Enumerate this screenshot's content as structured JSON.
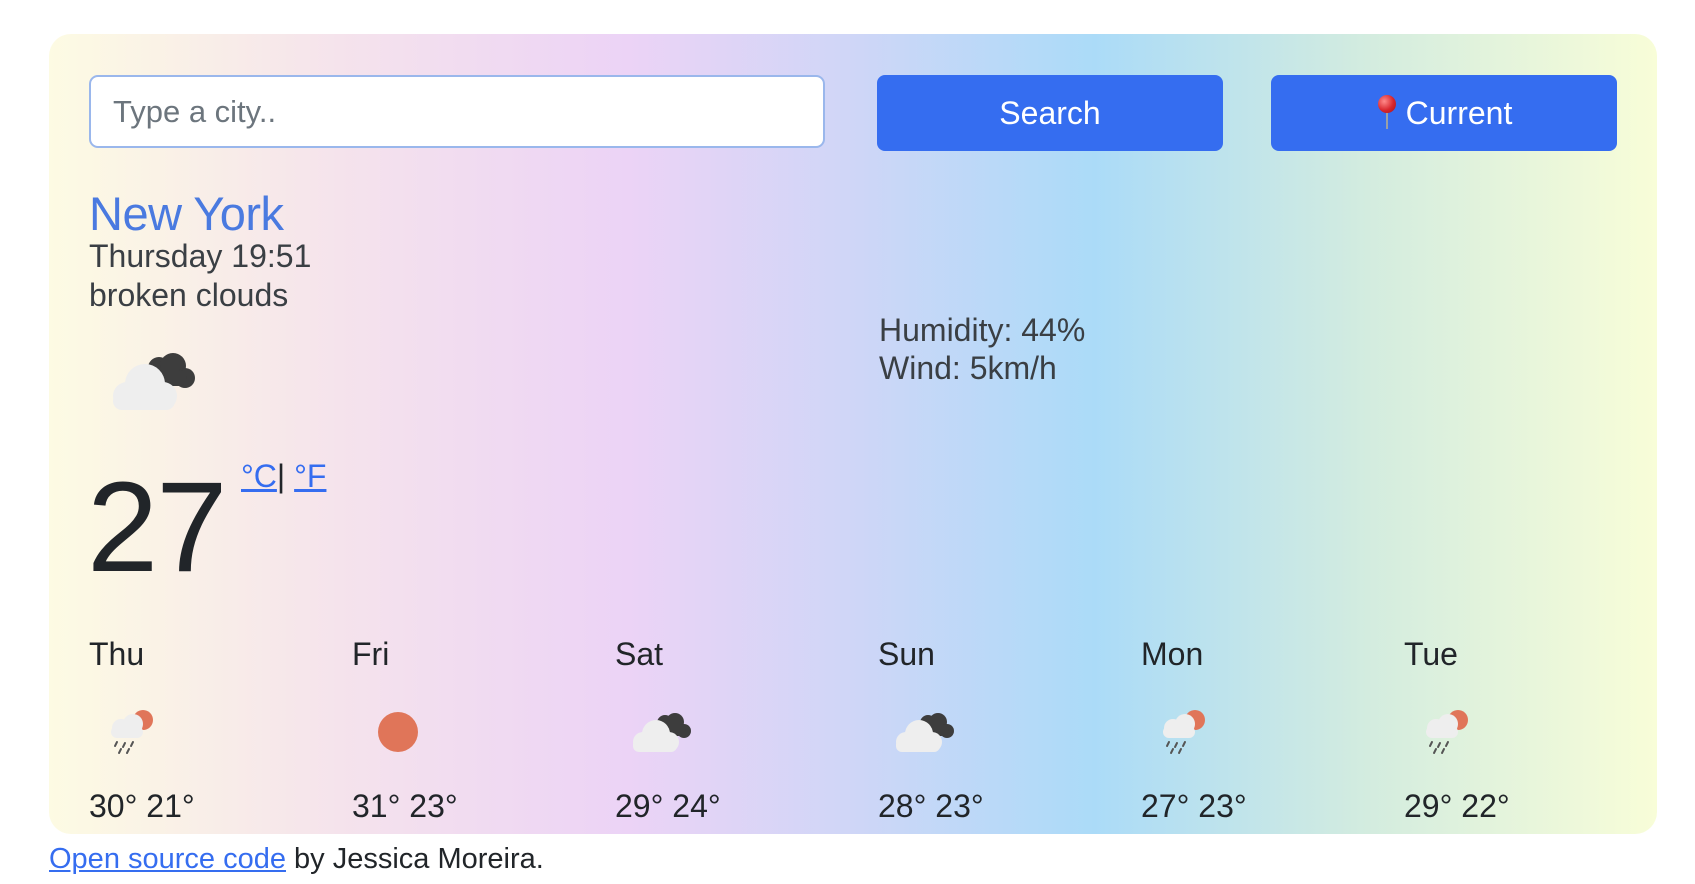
{
  "search": {
    "placeholder": "Type a city..",
    "value": "",
    "search_label": "Search",
    "current_label": "Current"
  },
  "weather": {
    "city": "New York",
    "datetime": "Thursday 19:51",
    "description": "broken clouds",
    "icon": "broken-clouds-icon",
    "temperature": "27",
    "unit_c": "°C",
    "unit_separator": "|",
    "unit_f": "°F",
    "humidity": "Humidity: 44%",
    "wind": "Wind: 5km/h"
  },
  "forecast": [
    {
      "day": "Thu",
      "icon": "rain-sun-icon",
      "temps": "30° 21°"
    },
    {
      "day": "Fri",
      "icon": "sun-icon",
      "temps": "31° 23°"
    },
    {
      "day": "Sat",
      "icon": "broken-clouds-icon",
      "temps": "29° 24°"
    },
    {
      "day": "Sun",
      "icon": "broken-clouds-icon",
      "temps": "28° 23°"
    },
    {
      "day": "Mon",
      "icon": "rain-sun-icon",
      "temps": "27° 23°"
    },
    {
      "day": "Tue",
      "icon": "rain-sun-icon",
      "temps": "29° 22°"
    }
  ],
  "footer": {
    "link_text": "Open source code",
    "rest_text": " by Jessica Moreira."
  },
  "colors": {
    "accent": "#356df0",
    "city": "#4a7ae0",
    "sun": "#e07559"
  }
}
